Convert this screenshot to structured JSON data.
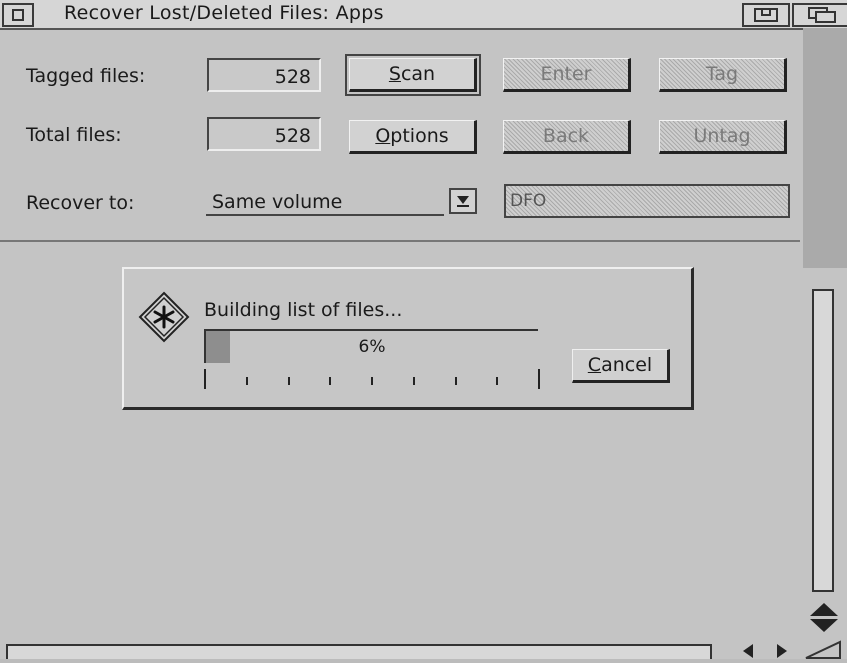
{
  "window": {
    "title": "Recover Lost/Deleted Files: Apps",
    "icons": {
      "close": "close-box-icon",
      "iconize": "iconize-icon",
      "toggle_size": "toggle-size-icon"
    }
  },
  "fields": {
    "tagged_label": "Tagged files:",
    "tagged_value": "528",
    "total_label": "Total files:",
    "total_value": "528",
    "recover_label": "Recover to:",
    "recover_value": "Same volume",
    "path_value": "DFO"
  },
  "buttons": {
    "scan_prefix": "",
    "scan_u": "S",
    "scan_rest": "can",
    "options_u": "O",
    "options_rest": "ptions",
    "enter": "Enter",
    "tag": "Tag",
    "back": "Back",
    "untag": "Untag"
  },
  "dialog": {
    "message": "Building list of files...",
    "progress_text": "6%",
    "progress": 0.06,
    "cancel_u": "C",
    "cancel_rest": "ancel",
    "icon": "busy-star-icon"
  },
  "colors": {
    "window_bg": "#c4c4c4",
    "progress_fill": "#8e8e8e",
    "scroll_well": "#aaaaaa"
  }
}
